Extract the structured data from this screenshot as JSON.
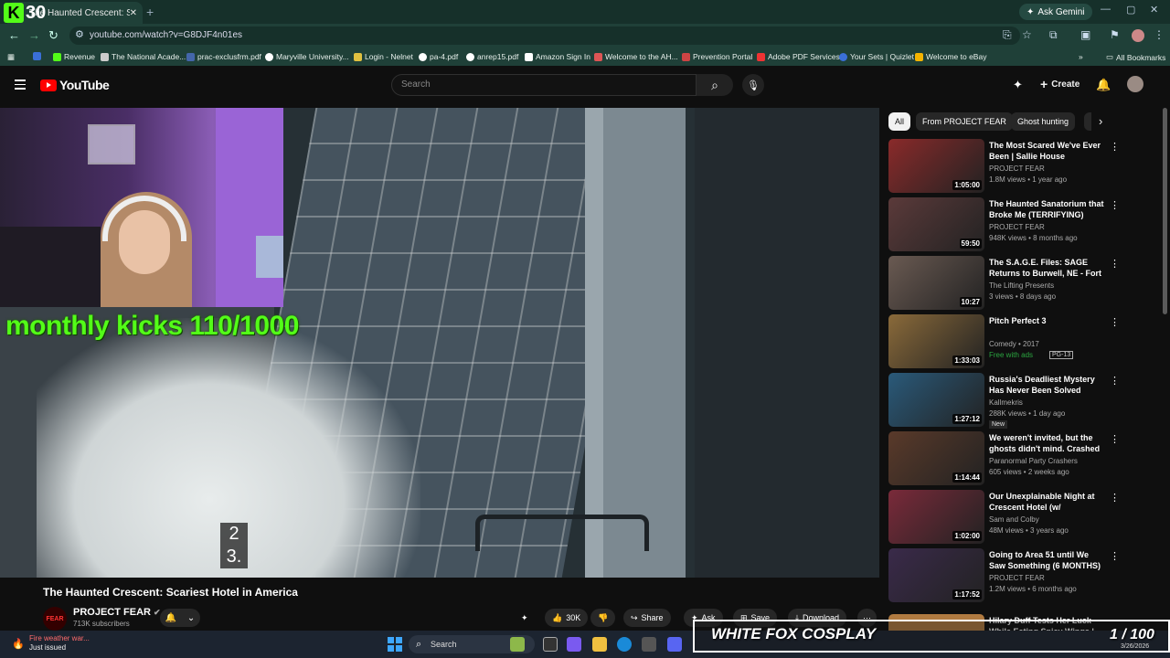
{
  "browser": {
    "tab_title": "The Haunted Crescent: Scar",
    "kick_counter": "30",
    "ask_gemini": "Ask Gemini",
    "url": "youtube.com/watch?v=G8DJF4n01es",
    "bookmarks": [
      "Revenue",
      "The National Acade...",
      "prac-exclusfrm.pdf",
      "Maryville University...",
      "Login - Nelnet",
      "pa-4.pdf",
      "anrep15.pdf",
      "Amazon Sign In",
      "Welcome to the AH...",
      "Prevention Portal",
      "Adobe PDF Services",
      "Your Sets | Quizlet",
      "Welcome to eBay"
    ],
    "all_bookmarks": "All Bookmarks",
    "colors": {
      "frame": "#16302a",
      "toolbar": "#1f4038"
    }
  },
  "youtube": {
    "logo_text": "YouTube",
    "search_placeholder": "Search",
    "create_label": "Create",
    "overlay_kicks": "monthly kicks 110/1000",
    "counter_lines": [
      "2",
      "3."
    ],
    "video_title": "The Haunted Crescent: Scariest Hotel in America",
    "channel_logo_text": "FEAR",
    "channel_name": "PROJECT FEAR",
    "subscribers": "713K subscribers",
    "likes": "30K",
    "share": "Share",
    "ask": "Ask",
    "save": "Save",
    "download": "Download",
    "chips": [
      "All",
      "From PROJECT FEAR",
      "Ghost hunting"
    ],
    "recommendations": [
      {
        "title": "The Most Scared We've Ever Been | Sallie House",
        "channel": "PROJECT FEAR",
        "meta": "1.8M views • 1 year ago",
        "duration": "1:05:00",
        "color": "#8a2a2a"
      },
      {
        "title": "The Haunted Sanatorium that Broke Me (TERRIFYING)",
        "channel": "PROJECT FEAR",
        "meta": "948K views • 8 months ago",
        "duration": "59:50",
        "color": "#5b3a3a"
      },
      {
        "title": "The S.A.G.E. Files: SAGE Returns to Burwell, NE - Fort ...",
        "channel": "The Lifting Presents",
        "meta": "3 views • 8 days ago",
        "duration": "10:27",
        "color": "#6a5a52"
      },
      {
        "title": "Pitch Perfect 3",
        "channel": "Comedy • 2017",
        "meta": "Free with ads",
        "rating": "PG-13",
        "duration": "1:33:03",
        "color": "#8a6a3a"
      },
      {
        "title": "Russia's Deadliest Mystery Has Never Been Solved",
        "channel": "Kallmekris",
        "meta": "288K views • 1 day ago",
        "badge": "New",
        "duration": "1:27:12",
        "color": "#2a5a7a"
      },
      {
        "title": "We weren't invited, but the ghosts didn't mind. Crashed a ...",
        "channel": "Paranormal Party Crashers",
        "meta": "605 views • 2 weeks ago",
        "duration": "1:14:44",
        "color": "#5a3a2a"
      },
      {
        "title": "Our Unexplainable Night at Crescent Hotel (w/ KallmeKris ...",
        "channel": "Sam and Colby",
        "meta": "48M views • 3 years ago",
        "duration": "1:02:00",
        "color": "#7a2a3a"
      },
      {
        "title": "Going to Area 51 until We Saw Something (6 MONTHS)",
        "channel": "PROJECT FEAR",
        "meta": "1.2M views • 6 months ago",
        "duration": "1:17:52",
        "color": "#3a2a4a"
      }
    ],
    "partial_rec_title": "Hilary Duff Tests Her Luck While Eating Spicy Wings | Hot Ones"
  },
  "taskbar": {
    "weather_title": "Fire weather war...",
    "weather_sub": "Just issued",
    "search": "Search",
    "overlay_text": "WHITE FOX COSPLAY",
    "overlay_count": "1 / 100",
    "date": "3/26/2026"
  }
}
